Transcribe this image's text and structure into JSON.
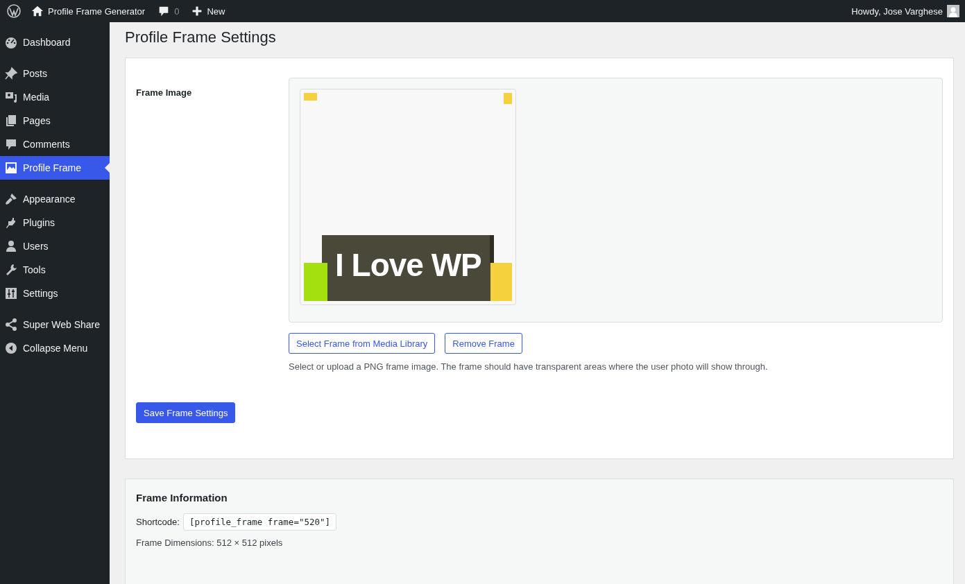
{
  "admin_bar": {
    "site_title": "Profile Frame Generator",
    "comments_count": "0",
    "new_label": "New",
    "greeting": "Howdy, Jose Varghese"
  },
  "sidebar": {
    "groups": [
      [
        {
          "label": "Dashboard",
          "selected": false
        }
      ],
      [
        {
          "label": "Posts",
          "selected": false
        },
        {
          "label": "Media",
          "selected": false
        },
        {
          "label": "Pages",
          "selected": false
        },
        {
          "label": "Comments",
          "selected": false
        },
        {
          "label": "Profile Frame",
          "selected": true
        }
      ],
      [
        {
          "label": "Appearance",
          "selected": false
        },
        {
          "label": "Plugins",
          "selected": false
        },
        {
          "label": "Users",
          "selected": false
        },
        {
          "label": "Tools",
          "selected": false
        },
        {
          "label": "Settings",
          "selected": false
        }
      ],
      [
        {
          "label": "Super Web Share",
          "selected": false
        },
        {
          "label": "Collapse Menu",
          "selected": false
        }
      ]
    ]
  },
  "page_title": "Profile Frame Settings",
  "settings": {
    "field_label": "Frame Image",
    "frame_text": "I Love WP",
    "buttons": [
      "Select Frame from Media Library",
      "Remove Frame"
    ],
    "description": "Select or upload a PNG frame image. The frame should have transparent areas where the user photo will show through.",
    "save_button": "Save Frame Settings"
  },
  "info": {
    "title": "Frame Information",
    "shortcode_label": "Shortcode:",
    "shortcode": "[profile_frame frame=\"520\"]",
    "dimensions": "Frame Dimensions: 512 × 512 pixels"
  }
}
